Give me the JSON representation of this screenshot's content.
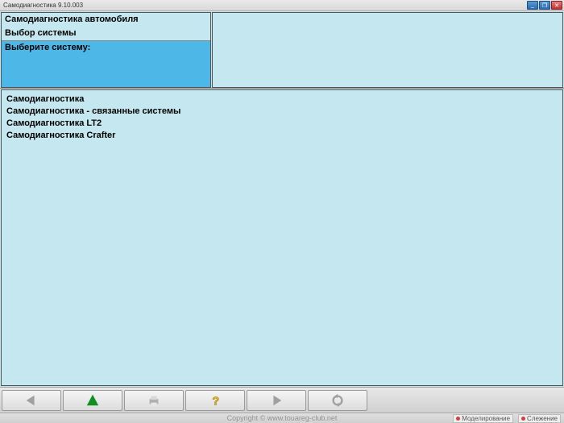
{
  "titlebar": {
    "text": "Самодиагностика 9.10.003"
  },
  "left_panel": {
    "line1": "Самодиагностика автомобиля",
    "line2": "Выбор системы",
    "prompt": "Выберите систему:"
  },
  "list": [
    "Самодиагностика",
    "Самодиагностика - связанные системы",
    "Самодиагностика LT2",
    "Самодиагностика Crafter"
  ],
  "footer": {
    "copyright": "Copyright © www.touareg-club.net",
    "status1": "Моделирование",
    "status2": "Слежение"
  }
}
